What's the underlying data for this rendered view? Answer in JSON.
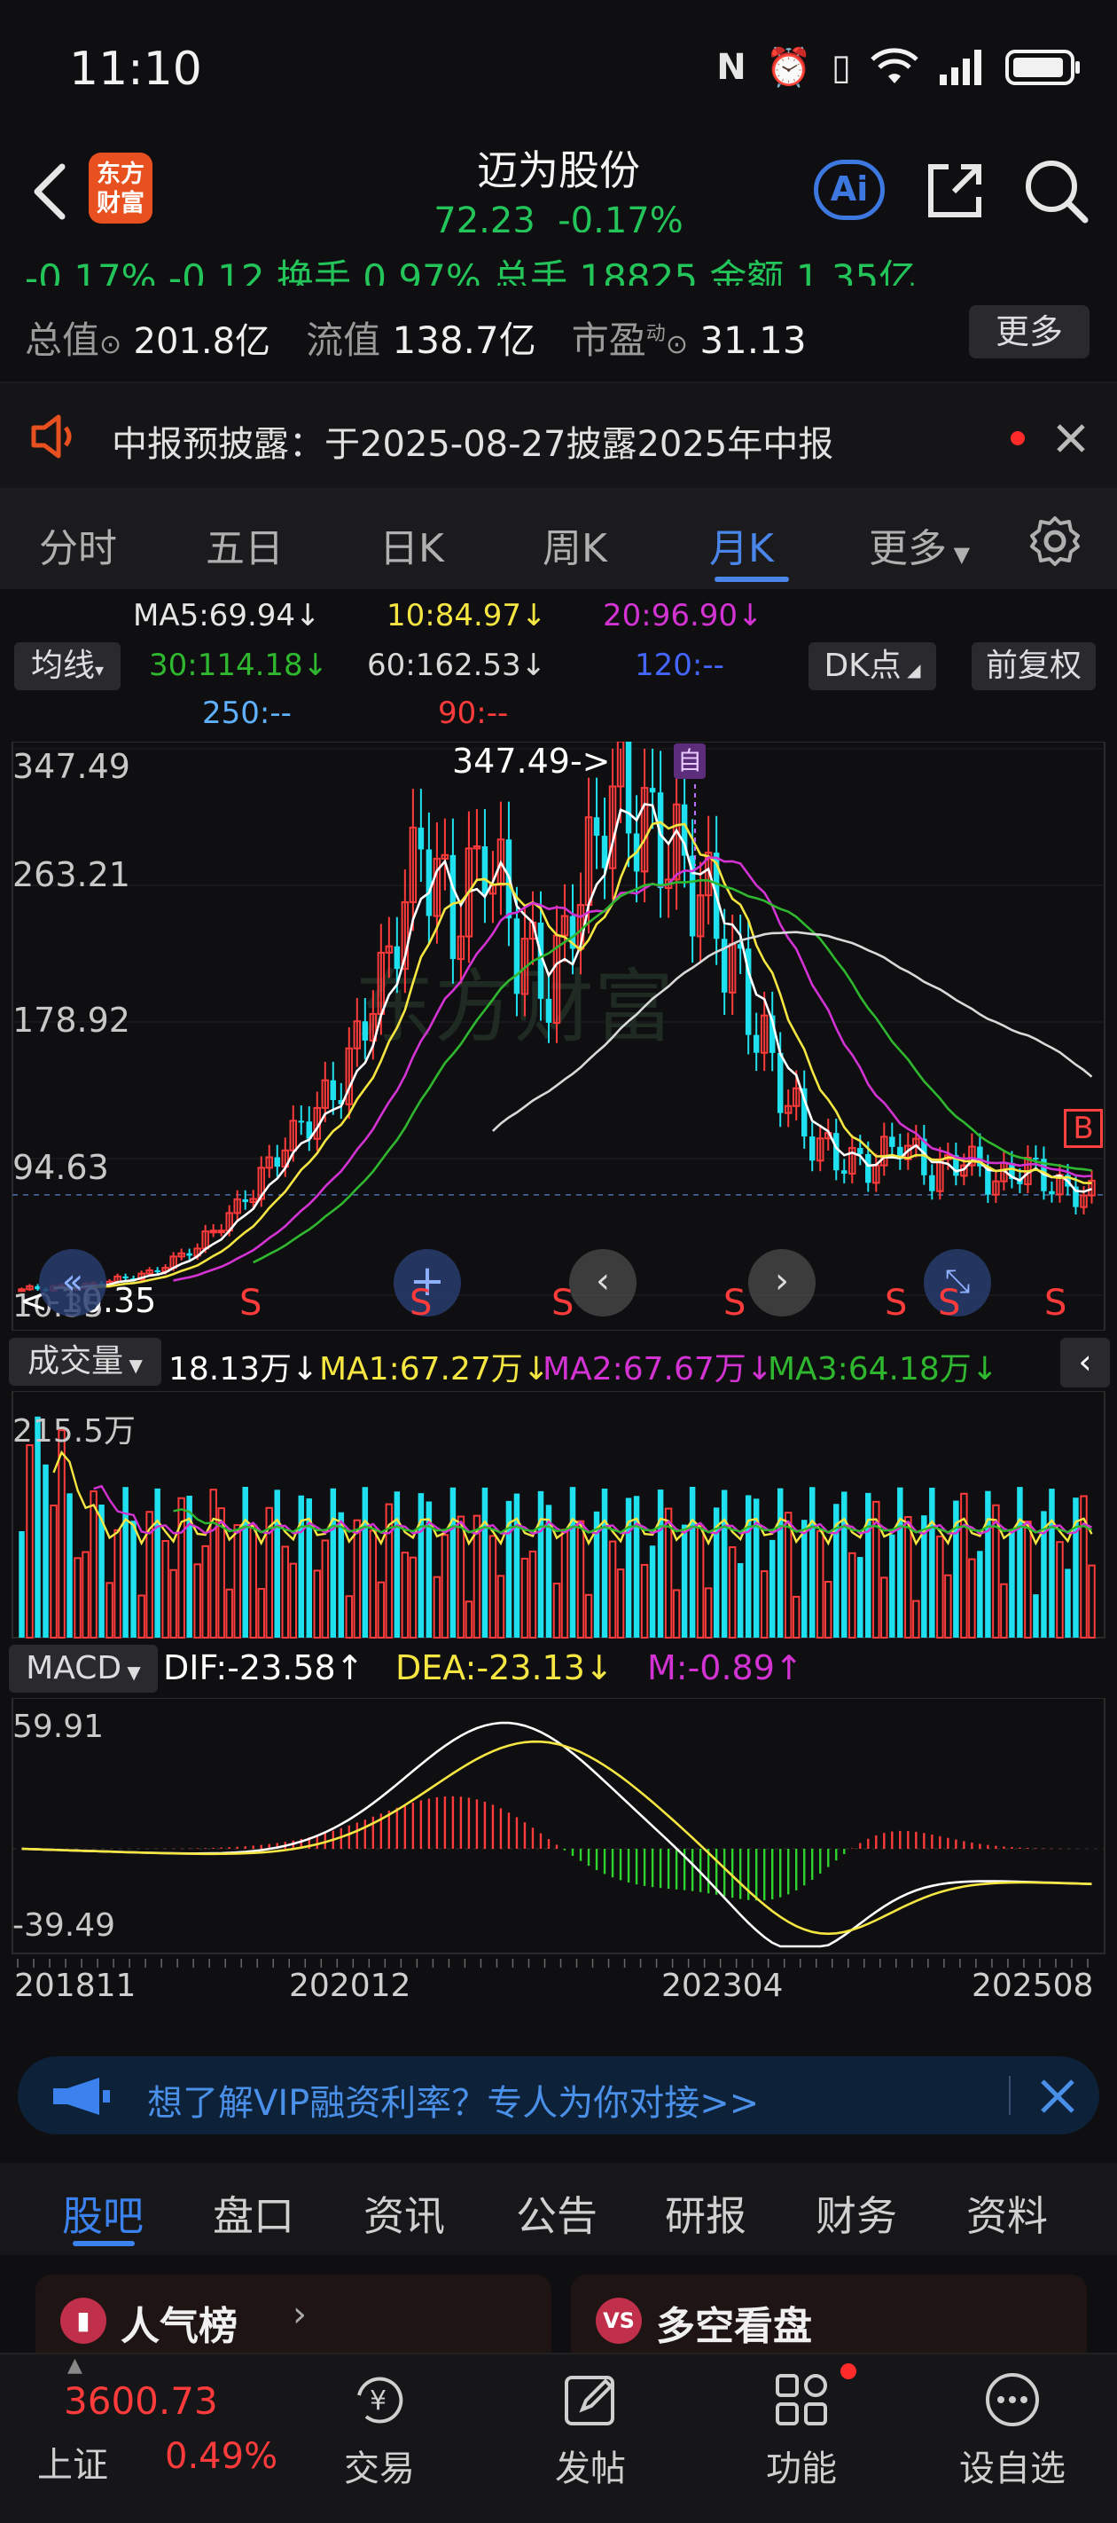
{
  "status": {
    "time": "11:10"
  },
  "header": {
    "back_label": "<",
    "logo_text_1": "东方",
    "logo_text_2": "财富",
    "title": "迈为股份",
    "price": "72.23",
    "change_pct": "-0.17%",
    "ai_label": "Ai"
  },
  "quote_strip": {
    "text": "-0.17%  -0.12   换手 0.97%   总手   18825   金额   1.35亿"
  },
  "quote_row": {
    "total_value_label": "总值",
    "total_value": "201.8亿",
    "float_label": "流值",
    "float_value": "138.7亿",
    "pe_label": "市盈",
    "pe_sup": "动",
    "pe_value": "31.13",
    "more_label": "更多"
  },
  "notice": {
    "text": "中报预披露：于2025-08-27披露2025年中报"
  },
  "tabs": [
    {
      "label": "分时"
    },
    {
      "label": "五日"
    },
    {
      "label": "日K"
    },
    {
      "label": "周K"
    },
    {
      "label": "月K"
    },
    {
      "label": "更多"
    }
  ],
  "ma": {
    "selector": "均线",
    "ma5": "MA5:69.94↓",
    "ma10": "10:84.97↓",
    "ma20": "20:96.90↓",
    "ma30": "30:114.18↓",
    "ma60": "60:162.53↓",
    "ma120": "120:--",
    "ma250": "250:--",
    "ma90": "90:--",
    "dk_label": "DK点",
    "fq_label": "前复权",
    "colors": {
      "ma5": "#ffffff",
      "ma10": "#f5e642",
      "ma20": "#d433d4",
      "ma30": "#2fb82f",
      "ma60": "#d9d9d9",
      "ma120": "#4466ff",
      "ma250": "#5fb0ff",
      "ma90": "#ff3b3b"
    }
  },
  "price_axis": {
    "top": "347.49",
    "l2": "263.21",
    "l3": "178.92",
    "l4": "94.63",
    "bottom": "10.35"
  },
  "chart_annotations": {
    "high_label": "347.49->",
    "low_label": "<-10.35",
    "self_tag": "自",
    "b_tag": "B",
    "s_tag": "S",
    "watermark": "东方财富"
  },
  "volume": {
    "selector": "成交量",
    "current": "18.13万↓",
    "ma1": "MA1:67.27万↓",
    "ma2": "MA2:67.67万↓",
    "ma3": "MA3:64.18万↓",
    "top_label": "215.5万"
  },
  "macd": {
    "selector": "MACD",
    "dif": "DIF:-23.58↑",
    "dea": "DEA:-23.13↓",
    "m": "M:-0.89↑",
    "top_label": "59.91",
    "bottom_label": "-39.49"
  },
  "x_axis": {
    "d1": "201811",
    "d2": "202012",
    "d3": "202304",
    "d4": "202508"
  },
  "vip": {
    "text": "想了解VIP融资利率？专人为你对接>>"
  },
  "sub_tabs": [
    {
      "label": "股吧"
    },
    {
      "label": "盘口"
    },
    {
      "label": "资讯"
    },
    {
      "label": "公告"
    },
    {
      "label": "研报"
    },
    {
      "label": "财务"
    },
    {
      "label": "资料"
    }
  ],
  "cards": {
    "popular": "人气榜",
    "bullbear": "多空看盘"
  },
  "bottom_bar": {
    "index_value": "3600.73",
    "index_name": "上证",
    "index_change": "0.49%",
    "trade": "交易",
    "post": "发帖",
    "functions": "功能",
    "settings": "设自选"
  },
  "chart_data": {
    "type": "candlestick",
    "x_ticks": [
      "201811",
      "202012",
      "202304",
      "202508"
    ],
    "price_ylim": [
      10.35,
      347.49
    ],
    "price_ticks": [
      347.49,
      263.21,
      178.92,
      94.63,
      10.35
    ],
    "last_close": 72.23,
    "high": 347.49,
    "low": 10.35,
    "ma": {
      "MA5": 69.94,
      "MA10": 84.97,
      "MA20": 96.9,
      "MA30": 114.18,
      "MA60": 162.53
    },
    "volume_top": "215.5万",
    "macd": {
      "dif": -23.58,
      "dea": -23.13,
      "m": -0.89,
      "ylim": [
        -39.49,
        59.91
      ]
    }
  }
}
